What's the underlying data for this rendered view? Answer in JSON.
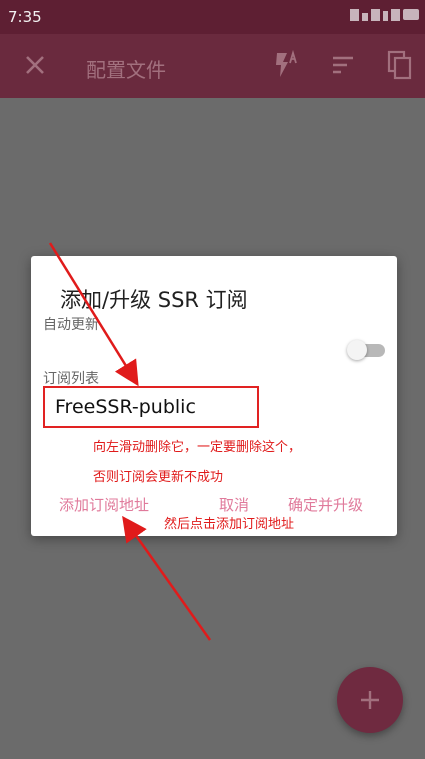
{
  "status_bar": {
    "time": "7:35"
  },
  "app_bar": {
    "title": "配置文件",
    "icons": [
      "close-icon",
      "flash-auto-icon",
      "sort-icon",
      "copy-icon"
    ]
  },
  "dialog": {
    "title": "添加/升级 SSR 订阅",
    "auto_update_label": "自动更新",
    "auto_update_on": false,
    "subscription_list_label": "订阅列表",
    "subscriptions": [
      "FreeSSR-public"
    ],
    "buttons": {
      "add": "添加订阅地址",
      "cancel": "取消",
      "confirm": "确定并升级"
    }
  },
  "annotations": {
    "note_line1": "向左滑动删除它，一定要删除这个，",
    "note_line2": "否则订阅会更新不成功",
    "note_then": "然后点击添加订阅地址"
  },
  "colors": {
    "primary": "#6a2a3e",
    "accent_text": "#e07a9b",
    "annotation_red": "#e01b1b"
  },
  "fab": {
    "icon": "plus-icon"
  }
}
